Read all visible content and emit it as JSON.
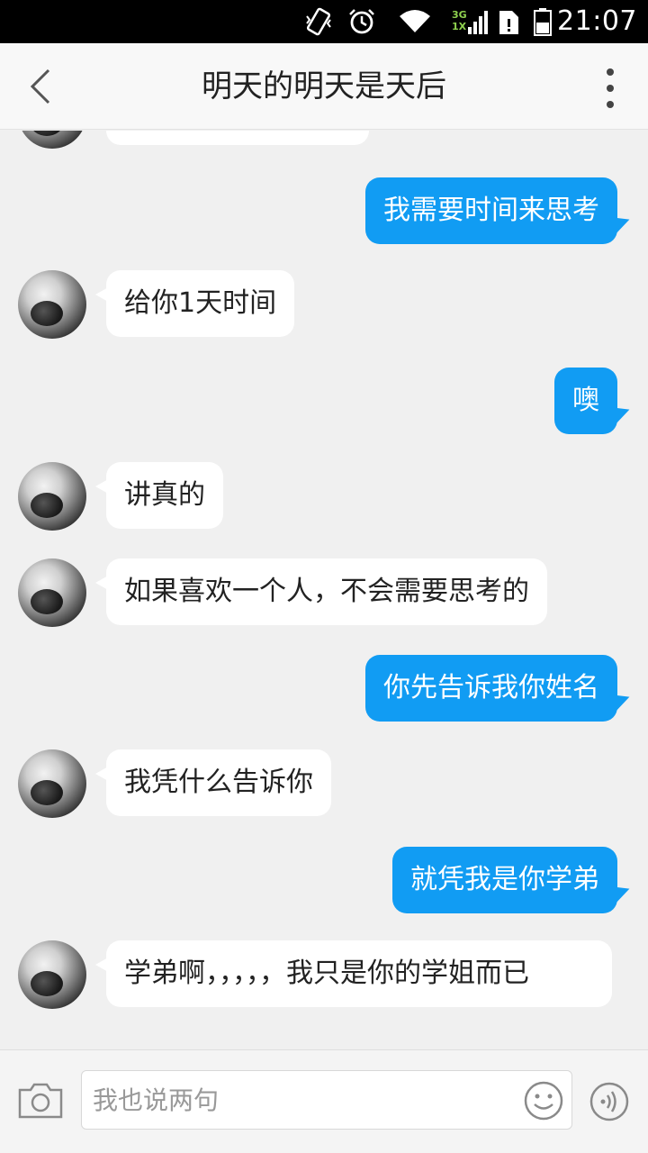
{
  "status_bar": {
    "time": "21:07",
    "network_top": "3G",
    "network_bottom": "1X"
  },
  "header": {
    "title": "明天的明天是天后",
    "back_icon": "back-arrow-icon",
    "more_icon": "more-vertical-icon"
  },
  "messages": [
    {
      "side": "left",
      "text": ""
    },
    {
      "side": "right",
      "text": "我需要时间来思考"
    },
    {
      "side": "left",
      "text": "给你1天时间"
    },
    {
      "side": "right",
      "text": "噢"
    },
    {
      "side": "left",
      "text": "讲真的"
    },
    {
      "side": "left",
      "text": "如果喜欢一个人，不会需要思考的"
    },
    {
      "side": "right",
      "text": "你先告诉我你姓名"
    },
    {
      "side": "left",
      "text": "我凭什么告诉你"
    },
    {
      "side": "right",
      "text": "就凭我是你学弟"
    },
    {
      "side": "left",
      "text": "学弟啊，，，，，我只是你的学姐而已"
    }
  ],
  "input_bar": {
    "placeholder": "我也说两句",
    "value": ""
  },
  "colors": {
    "sent_bubble": "#119cf3",
    "received_bubble": "#ffffff",
    "background": "#f0f0f0"
  }
}
